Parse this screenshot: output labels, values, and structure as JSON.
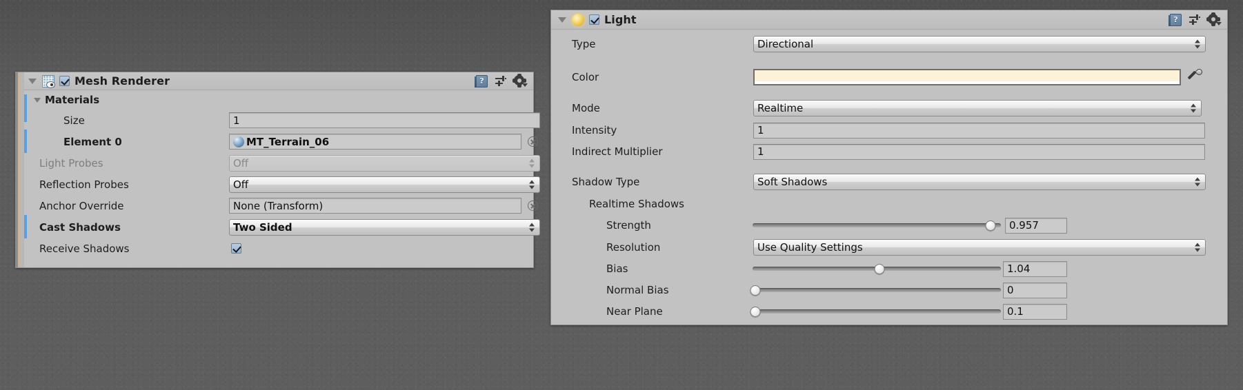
{
  "mesh_renderer": {
    "title": "Mesh Renderer",
    "enabled": true,
    "icons": {
      "help": "help-icon",
      "preset": "preset-icon",
      "gear": "gear-icon"
    },
    "materials_foldout": "Materials",
    "rows": [
      {
        "label": "Size",
        "bold": false,
        "dim": false,
        "override": false,
        "widget": "text",
        "value": "1"
      },
      {
        "label": "Element 0",
        "bold": true,
        "dim": false,
        "override": true,
        "widget": "object",
        "value": "MT_Terrain_06",
        "has_picker": true
      },
      {
        "label": "Light Probes",
        "bold": false,
        "dim": true,
        "override": false,
        "widget": "dropdown",
        "value": "Off",
        "disabled": true
      },
      {
        "label": "Reflection Probes",
        "bold": false,
        "dim": false,
        "override": false,
        "widget": "dropdown",
        "value": "Off",
        "disabled": false
      },
      {
        "label": "Anchor Override",
        "bold": false,
        "dim": false,
        "override": false,
        "widget": "object",
        "value": "None (Transform)",
        "has_picker": true
      },
      {
        "label": "Cast Shadows",
        "bold": true,
        "dim": false,
        "override": true,
        "widget": "dropdown",
        "value": "Two Sided",
        "disabled": false
      },
      {
        "label": "Receive Shadows",
        "bold": false,
        "dim": false,
        "override": false,
        "widget": "checkbox",
        "value": true
      }
    ]
  },
  "light": {
    "title": "Light",
    "enabled": true,
    "icons": {
      "help": "help-icon",
      "preset": "preset-icon",
      "gear": "gear-icon"
    },
    "rows": [
      {
        "label": "Type",
        "indent": 0,
        "widget": "dropdown",
        "value": "Directional"
      },
      {
        "label": "Color",
        "indent": 0,
        "widget": "color",
        "value": "#fbf2d8",
        "alpha": "#ffffff"
      },
      {
        "label": "Mode",
        "indent": 0,
        "widget": "dropdown",
        "value": "Realtime"
      },
      {
        "label": "Intensity",
        "indent": 0,
        "widget": "text",
        "value": "1"
      },
      {
        "label": "Indirect Multiplier",
        "indent": 0,
        "widget": "text",
        "value": "1"
      },
      {
        "label": "Shadow Type",
        "indent": 0,
        "widget": "dropdown",
        "value": "Soft Shadows"
      },
      {
        "label": "Realtime Shadows",
        "indent": 1,
        "widget": "none",
        "value": ""
      },
      {
        "label": "Strength",
        "indent": 2,
        "widget": "slider",
        "value": "0.957",
        "percent": 95.7
      },
      {
        "label": "Resolution",
        "indent": 2,
        "widget": "dropdown",
        "value": "Use Quality Settings"
      },
      {
        "label": "Bias",
        "indent": 2,
        "widget": "slider",
        "value": "1.04",
        "percent": 51
      },
      {
        "label": "Normal Bias",
        "indent": 2,
        "widget": "slider",
        "value": "0",
        "percent": 0
      },
      {
        "label": "Near Plane",
        "indent": 2,
        "widget": "slider",
        "value": "0.1",
        "percent": 0
      }
    ]
  },
  "colors": {
    "panel_bg": "#c2c2c2",
    "override_marker": "#5a9fe0",
    "checkbox_fill": "#a5c0dc",
    "light_color_swatch": "#fbf2d8"
  }
}
